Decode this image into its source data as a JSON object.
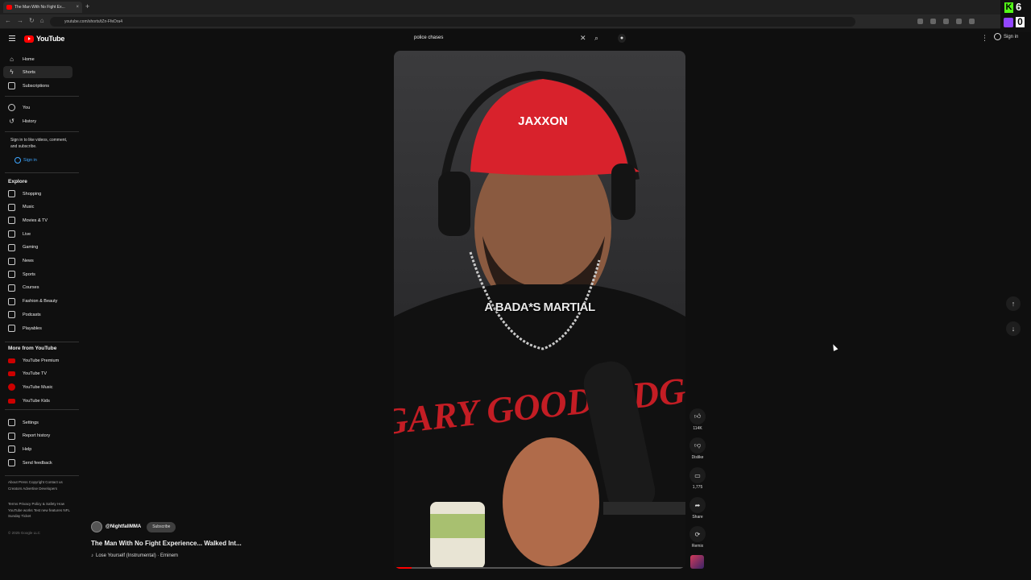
{
  "browser": {
    "tab_title": "The Man With No Fight Ex...",
    "url": "youtube.com/shorts/tZn-FfeDra4",
    "overlay": {
      "kick_count": "6",
      "other_count": "0"
    }
  },
  "header": {
    "logo_text": "YouTube",
    "search_value": "police chases",
    "signin_label": "Sign in"
  },
  "sidebar": {
    "main": [
      {
        "label": "Home",
        "icon": "home-icon"
      },
      {
        "label": "Shorts",
        "icon": "shorts-icon"
      },
      {
        "label": "Subscriptions",
        "icon": "subscriptions-icon"
      }
    ],
    "you": [
      {
        "label": "You",
        "icon": "you-icon"
      },
      {
        "label": "History",
        "icon": "history-icon"
      }
    ],
    "signin_prompt": "Sign in to like videos, comment, and subscribe.",
    "signin_label": "Sign in",
    "explore_heading": "Explore",
    "explore": [
      {
        "label": "Shopping",
        "icon": "shopping-icon"
      },
      {
        "label": "Music",
        "icon": "music-icon"
      },
      {
        "label": "Movies & TV",
        "icon": "movies-icon"
      },
      {
        "label": "Live",
        "icon": "live-icon"
      },
      {
        "label": "Gaming",
        "icon": "gaming-icon"
      },
      {
        "label": "News",
        "icon": "news-icon"
      },
      {
        "label": "Sports",
        "icon": "sports-icon"
      },
      {
        "label": "Courses",
        "icon": "courses-icon"
      },
      {
        "label": "Fashion & Beauty",
        "icon": "fashion-icon"
      },
      {
        "label": "Podcasts",
        "icon": "podcasts-icon"
      },
      {
        "label": "Playables",
        "icon": "playables-icon"
      }
    ],
    "more_heading": "More from YouTube",
    "more": [
      {
        "label": "YouTube Premium",
        "icon": "youtube-premium-icon"
      },
      {
        "label": "YouTube TV",
        "icon": "youtube-tv-icon"
      },
      {
        "label": "YouTube Music",
        "icon": "youtube-music-icon"
      },
      {
        "label": "YouTube Kids",
        "icon": "youtube-kids-icon"
      }
    ],
    "settings": [
      {
        "label": "Settings",
        "icon": "gear-icon"
      },
      {
        "label": "Report history",
        "icon": "flag-icon"
      },
      {
        "label": "Help",
        "icon": "help-icon"
      },
      {
        "label": "Send feedback",
        "icon": "feedback-icon"
      }
    ],
    "footer1": "About  Press  Copyright  Contact us  Creators  Advertise  Developers",
    "footer2": "Terms  Privacy  Policy & Safety  How YouTube works  Test new features  NFL Sunday Ticket",
    "copyright": "© 2025 Google LLC"
  },
  "video": {
    "caption": "A BADA*S MARTIAL",
    "cap_text": "JAXXON",
    "shirt_text": "GARY GOODRIDGE",
    "progress": 0.06
  },
  "channel": {
    "handle": "@NightfallMMA",
    "subscribe_label": "Subscribe",
    "title": "The Man With No Fight Experience... Walked Int...",
    "music": "Lose Yourself (Instrumental) · Eminem"
  },
  "actions": {
    "likes": "114K",
    "dislike_label": "Dislike",
    "comments": "1,775",
    "share_label": "Share",
    "remix_label": "Remix"
  }
}
